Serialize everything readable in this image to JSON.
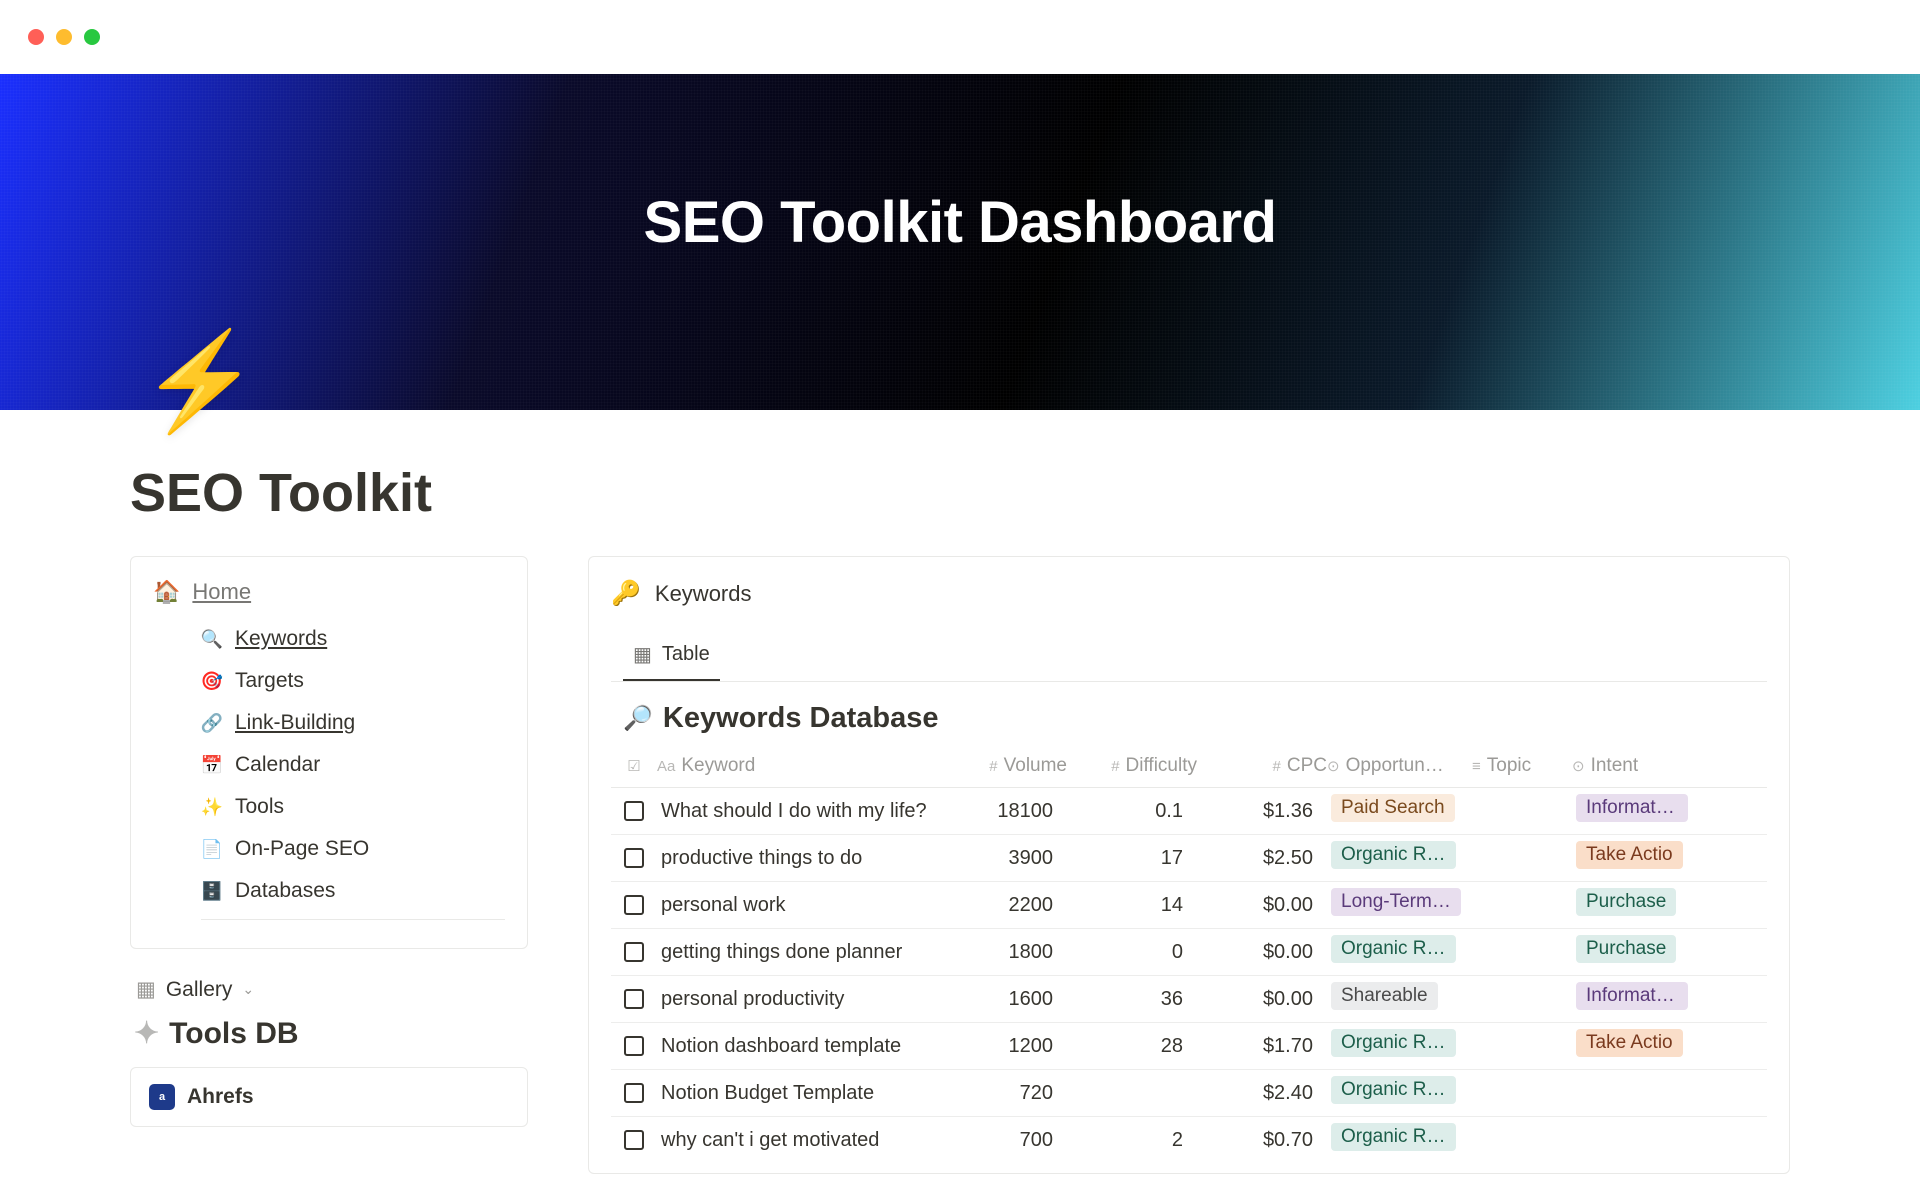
{
  "hero": {
    "title": "SEO Toolkit Dashboard"
  },
  "page": {
    "icon": "⚡",
    "title": "SEO Toolkit"
  },
  "sidebar": {
    "home": {
      "icon": "🏠",
      "label": "Home"
    },
    "items": [
      {
        "icon": "🔍",
        "label": "Keywords",
        "underline": true
      },
      {
        "icon": "🎯",
        "label": "Targets",
        "underline": false
      },
      {
        "icon": "🔗",
        "label": "Link-Building",
        "underline": true
      },
      {
        "icon": "📅",
        "label": "Calendar",
        "underline": false
      },
      {
        "icon": "✨",
        "label": "Tools",
        "underline": false
      },
      {
        "icon": "📄",
        "label": "On-Page SEO",
        "underline": false
      },
      {
        "icon": "🗄️",
        "label": "Databases",
        "underline": false
      }
    ]
  },
  "gallery": {
    "switcher": "Gallery"
  },
  "tools_db": {
    "title": "Tools DB",
    "items": [
      {
        "badge": "a",
        "name": "Ahrefs"
      }
    ]
  },
  "keywords_panel": {
    "header": "Keywords",
    "tab": "Table",
    "db_title": "Keywords Database",
    "columns": {
      "keyword": "Keyword",
      "volume": "Volume",
      "difficulty": "Difficulty",
      "cpc": "CPC",
      "opportunity": "Opportun…",
      "topic": "Topic",
      "intent": "Intent"
    },
    "rows": [
      {
        "keyword": "What should I do with my life?",
        "volume": "18100",
        "difficulty": "0.1",
        "cpc": "$1.36",
        "opportunity": "Paid Search",
        "opp_color": "tag-orange-light",
        "topic": "",
        "intent": "Informati…",
        "intent_color": "tag-purple"
      },
      {
        "keyword": "productive things to do",
        "volume": "3900",
        "difficulty": "17",
        "cpc": "$2.50",
        "opportunity": "Organic R…",
        "opp_color": "tag-green",
        "topic": "",
        "intent": "Take Actio",
        "intent_color": "tag-orange"
      },
      {
        "keyword": "personal work",
        "volume": "2200",
        "difficulty": "14",
        "cpc": "$0.00",
        "opportunity": "Long-Term…",
        "opp_color": "tag-purple",
        "topic": "",
        "intent": "Purchase",
        "intent_color": "tag-green"
      },
      {
        "keyword": "getting things done planner",
        "volume": "1800",
        "difficulty": "0",
        "cpc": "$0.00",
        "opportunity": "Organic R…",
        "opp_color": "tag-green",
        "topic": "",
        "intent": "Purchase",
        "intent_color": "tag-green"
      },
      {
        "keyword": "personal productivity",
        "volume": "1600",
        "difficulty": "36",
        "cpc": "$0.00",
        "opportunity": "Shareable",
        "opp_color": "tag-gray",
        "topic": "",
        "intent": "Informati…",
        "intent_color": "tag-purple"
      },
      {
        "keyword": "Notion dashboard template",
        "volume": "1200",
        "difficulty": "28",
        "cpc": "$1.70",
        "opportunity": "Organic R…",
        "opp_color": "tag-green",
        "topic": "",
        "intent": "Take Actio",
        "intent_color": "tag-orange"
      },
      {
        "keyword": "Notion Budget Template",
        "volume": "720",
        "difficulty": "",
        "cpc": "$2.40",
        "opportunity": "Organic R…",
        "opp_color": "tag-green",
        "topic": "",
        "intent": "",
        "intent_color": ""
      },
      {
        "keyword": "why can't i get motivated",
        "volume": "700",
        "difficulty": "2",
        "cpc": "$0.70",
        "opportunity": "Organic R…",
        "opp_color": "tag-green",
        "topic": "",
        "intent": "",
        "intent_color": ""
      }
    ]
  }
}
